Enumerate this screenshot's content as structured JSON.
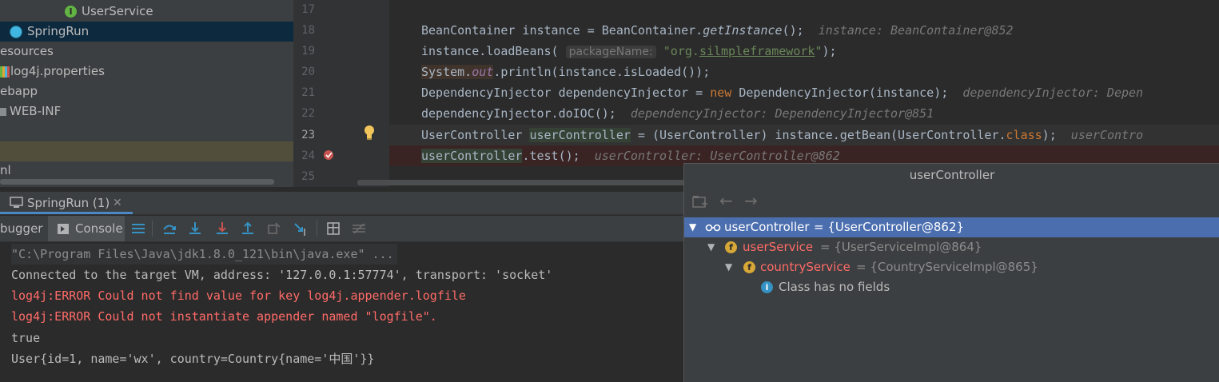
{
  "project_tree": {
    "items": [
      {
        "label": "UserService",
        "icon": "interface-icon"
      },
      {
        "label": "SpringRun",
        "icon": "spring-run-class-icon"
      },
      {
        "label": "esources",
        "icon": ""
      },
      {
        "label": "log4j.properties",
        "icon": "properties-file-icon"
      },
      {
        "label": "ebapp",
        "icon": ""
      },
      {
        "label": "WEB-INF",
        "icon": "folder-icon"
      },
      {
        "label": "",
        "icon": ""
      },
      {
        "label": "",
        "icon": ""
      },
      {
        "label": "nl",
        "icon": ""
      }
    ]
  },
  "editor": {
    "line_numbers": [
      "17",
      "18",
      "19",
      "20",
      "21",
      "22",
      "23",
      "24",
      "25"
    ],
    "current_line": "23",
    "breakpoint_line": "24",
    "inlay_hints": {
      "l18": "instance: BeanContainer@852",
      "l19_param": "packageName:",
      "l21": "dependencyInjector: Depen",
      "l22": "dependencyInjector: DependencyInjector@851",
      "l23": "userContro",
      "l24": "userController: UserController@862"
    }
  },
  "debug": {
    "session_tab": "SpringRun (1)",
    "debugger_tab": "bugger",
    "console_tab": "Console",
    "console_lines": [
      {
        "text": "\"C:\\Program Files\\Java\\jdk1.8.0_121\\bin\\java.exe\" ...",
        "kind": "cmd"
      },
      {
        "text": "Connected to the target VM, address: '127.0.0.1:57774', transport: 'socket'",
        "kind": "info"
      },
      {
        "text": "log4j:ERROR Could not find value for key log4j.appender.logfile",
        "kind": "err"
      },
      {
        "text": "log4j:ERROR Could not instantiate appender named \"logfile\".",
        "kind": "err"
      },
      {
        "text": "true",
        "kind": "info"
      },
      {
        "text": "User{id=1, name='wx', country=Country{name='中国'}}",
        "kind": "info"
      }
    ]
  },
  "variables_popup": {
    "title": "userController",
    "rows": [
      {
        "name": "userController",
        "value": "= {UserController@862}",
        "kind": "watch",
        "expanded": true,
        "selected": true
      },
      {
        "name": "userService",
        "value": "= {UserServiceImpl@864}",
        "kind": "field",
        "expanded": true,
        "selected": false
      },
      {
        "name": "countryService",
        "value": "= {CountryServiceImpl@865}",
        "kind": "field",
        "expanded": true,
        "selected": false
      },
      {
        "name": "Class has no fields",
        "value": "",
        "kind": "info",
        "expanded": false,
        "selected": false
      }
    ]
  },
  "colors": {
    "selection": "#4b6eaf",
    "error_text": "#ff6b68",
    "keyword": "#cc7832",
    "string": "#6a8759"
  }
}
